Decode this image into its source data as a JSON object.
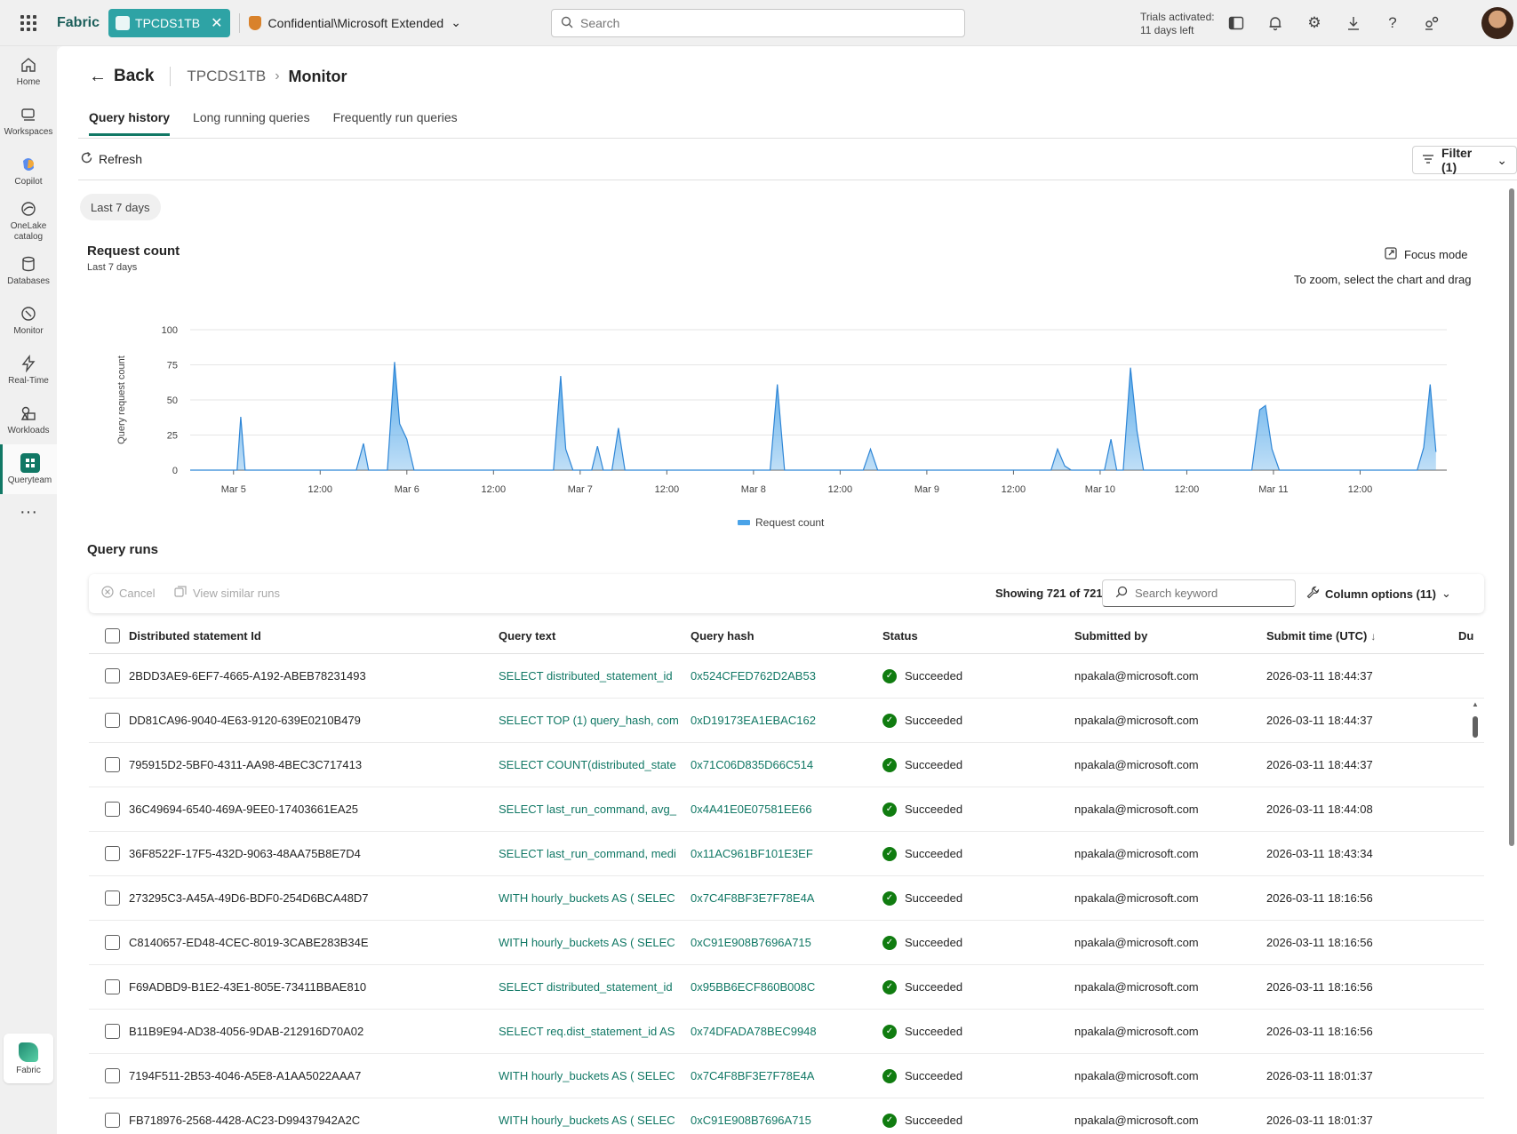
{
  "topbar": {
    "brand": "Fabric",
    "workspace": "TPCDS1TB",
    "sensitivity": "Confidential\\Microsoft Extended",
    "search_placeholder": "Search",
    "trials_line1": "Trials activated:",
    "trials_line2": "11 days left"
  },
  "rail": {
    "items": [
      {
        "label": "Home"
      },
      {
        "label": "Workspaces"
      },
      {
        "label": "Copilot"
      },
      {
        "label": "OneLake catalog"
      },
      {
        "label": "Databases"
      },
      {
        "label": "Monitor"
      },
      {
        "label": "Real-Time"
      },
      {
        "label": "Workloads"
      },
      {
        "label": "Queryteam"
      }
    ],
    "fabric_label": "Fabric"
  },
  "header": {
    "back_label": "Back",
    "crumb": "TPCDS1TB",
    "current": "Monitor"
  },
  "tabs": [
    {
      "label": "Query history"
    },
    {
      "label": "Long running queries"
    },
    {
      "label": "Frequently run queries"
    }
  ],
  "toolbar": {
    "refresh_label": "Refresh",
    "filter_label": "Filter (1)"
  },
  "range_pill": "Last 7 days",
  "chart_header": {
    "title": "Request count",
    "subtitle": "Last 7 days",
    "focus_label": "Focus mode",
    "zoom_hint": "To zoom, select the chart and drag"
  },
  "chart_data": {
    "type": "area",
    "title": "Request count",
    "subtitle": "Last 7 days",
    "ylabel": "Query request count",
    "xlabel": "",
    "ylim": [
      0,
      100
    ],
    "yticks": [
      0,
      25,
      50,
      75,
      100
    ],
    "xlim_hours": [
      -6,
      136
    ],
    "xticks": [
      {
        "label": "Mar 5",
        "hour": 0
      },
      {
        "label": "12:00",
        "hour": 12
      },
      {
        "label": "Mar 6",
        "hour": 24
      },
      {
        "label": "12:00",
        "hour": 36
      },
      {
        "label": "Mar 7",
        "hour": 48
      },
      {
        "label": "12:00",
        "hour": 60
      },
      {
        "label": "Mar 8",
        "hour": 72
      },
      {
        "label": "12:00",
        "hour": 84
      },
      {
        "label": "Mar 9",
        "hour": 96
      },
      {
        "label": "12:00",
        "hour": 108
      },
      {
        "label": "Mar 10",
        "hour": 120
      },
      {
        "label": "12:00",
        "hour": 132
      },
      {
        "label": "Mar 11",
        "hour": 144
      },
      {
        "label": "12:00",
        "hour": 156
      }
    ],
    "grid": true,
    "legend": "bottom",
    "series": [
      {
        "name": "Request count",
        "color": "#4aa3e8",
        "points": [
          [
            -6,
            0
          ],
          [
            0,
            0
          ],
          [
            0.5,
            0
          ],
          [
            1,
            38
          ],
          [
            1.6,
            0
          ],
          [
            17,
            0
          ],
          [
            18,
            19
          ],
          [
            18.7,
            0
          ],
          [
            21.3,
            0
          ],
          [
            22.3,
            77
          ],
          [
            23,
            33
          ],
          [
            24,
            22
          ],
          [
            25,
            0
          ],
          [
            44.3,
            0
          ],
          [
            45.3,
            67
          ],
          [
            46,
            15
          ],
          [
            47,
            0
          ],
          [
            49.6,
            0
          ],
          [
            50.4,
            17
          ],
          [
            51.2,
            0
          ],
          [
            52.4,
            0
          ],
          [
            53.3,
            30
          ],
          [
            54.2,
            0
          ],
          [
            74.3,
            0
          ],
          [
            75.3,
            61
          ],
          [
            76.3,
            0
          ],
          [
            87.2,
            0
          ],
          [
            88.2,
            15
          ],
          [
            89.2,
            0
          ],
          [
            113.2,
            0
          ],
          [
            114.1,
            15
          ],
          [
            115.1,
            3
          ],
          [
            116,
            0
          ],
          [
            120.6,
            0
          ],
          [
            121.5,
            22
          ],
          [
            122.3,
            0
          ],
          [
            123.2,
            0
          ],
          [
            124.2,
            73
          ],
          [
            125.1,
            28
          ],
          [
            126,
            0
          ],
          [
            141,
            0
          ],
          [
            142.1,
            43
          ],
          [
            142.9,
            46
          ],
          [
            143.8,
            15
          ],
          [
            144.8,
            0
          ],
          [
            163.9,
            0
          ],
          [
            164.8,
            16
          ],
          [
            165.7,
            61
          ],
          [
            166.5,
            13
          ]
        ]
      }
    ]
  },
  "query_runs": {
    "title": "Query runs",
    "cancel_label": "Cancel",
    "similar_label": "View similar runs",
    "showing": "Showing 721 of 721",
    "keyword_placeholder": "Search keyword",
    "column_options": "Column options (11)",
    "columns": [
      "Distributed statement Id",
      "Query text",
      "Query hash",
      "Status",
      "Submitted by",
      "Submit time (UTC)",
      "Du"
    ],
    "rows": [
      {
        "id": "2BDD3AE9-6EF7-4665-A192-ABEB78231493",
        "text": "SELECT distributed_statement_id",
        "hash": "0x524CFED762D2AB53",
        "status": "Succeeded",
        "by": "npakala@microsoft.com",
        "time": "2026-03-11 18:44:37"
      },
      {
        "id": "DD81CA96-9040-4E63-9120-639E0210B479",
        "text": "SELECT TOP (1) query_hash, com",
        "hash": "0xD19173EA1EBAC162",
        "status": "Succeeded",
        "by": "npakala@microsoft.com",
        "time": "2026-03-11 18:44:37"
      },
      {
        "id": "795915D2-5BF0-4311-AA98-4BEC3C717413",
        "text": "SELECT COUNT(distributed_state",
        "hash": "0x71C06D835D66C514",
        "status": "Succeeded",
        "by": "npakala@microsoft.com",
        "time": "2026-03-11 18:44:37"
      },
      {
        "id": "36C49694-6540-469A-9EE0-17403661EA25",
        "text": "SELECT last_run_command, avg_",
        "hash": "0x4A41E0E07581EE66",
        "status": "Succeeded",
        "by": "npakala@microsoft.com",
        "time": "2026-03-11 18:44:08"
      },
      {
        "id": "36F8522F-17F5-432D-9063-48AA75B8E7D4",
        "text": "SELECT last_run_command, medi",
        "hash": "0x11AC961BF101E3EF",
        "status": "Succeeded",
        "by": "npakala@microsoft.com",
        "time": "2026-03-11 18:43:34"
      },
      {
        "id": "273295C3-A45A-49D6-BDF0-254D6BCA48D7",
        "text": "WITH hourly_buckets AS ( SELEC",
        "hash": "0x7C4F8BF3E7F78E4A",
        "status": "Succeeded",
        "by": "npakala@microsoft.com",
        "time": "2026-03-11 18:16:56"
      },
      {
        "id": "C8140657-ED48-4CEC-8019-3CABE283B34E",
        "text": "WITH hourly_buckets AS ( SELEC",
        "hash": "0xC91E908B7696A715",
        "status": "Succeeded",
        "by": "npakala@microsoft.com",
        "time": "2026-03-11 18:16:56"
      },
      {
        "id": "F69ADBD9-B1E2-43E1-805E-73411BBAE810",
        "text": "SELECT distributed_statement_id",
        "hash": "0x95BB6ECF860B008C",
        "status": "Succeeded",
        "by": "npakala@microsoft.com",
        "time": "2026-03-11 18:16:56"
      },
      {
        "id": "B11B9E94-AD38-4056-9DAB-212916D70A02",
        "text": "SELECT req.dist_statement_id AS",
        "hash": "0x74DFADA78BEC9948",
        "status": "Succeeded",
        "by": "npakala@microsoft.com",
        "time": "2026-03-11 18:16:56"
      },
      {
        "id": "7194F511-2B53-4046-A5E8-A1AA5022AAA7",
        "text": "WITH hourly_buckets AS ( SELEC",
        "hash": "0x7C4F8BF3E7F78E4A",
        "status": "Succeeded",
        "by": "npakala@microsoft.com",
        "time": "2026-03-11 18:01:37"
      },
      {
        "id": "FB718976-2568-4428-AC23-D99437942A2C",
        "text": "WITH hourly_buckets AS ( SELEC",
        "hash": "0xC91E908B7696A715",
        "status": "Succeeded",
        "by": "npakala@microsoft.com",
        "time": "2026-03-11 18:01:37"
      }
    ]
  },
  "colors": {
    "accent": "#117865",
    "workspace_pill": "#2ea3a5",
    "success": "#107c10",
    "series": "#4aa3e8"
  }
}
